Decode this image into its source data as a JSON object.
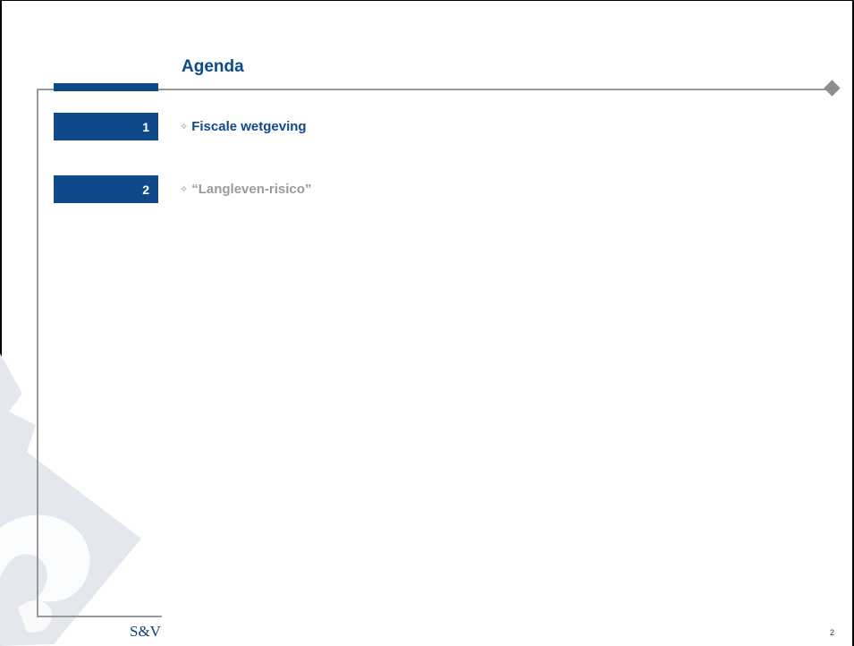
{
  "slide": {
    "title": "Agenda",
    "items": [
      {
        "number": "1",
        "label": "Fiscale wetgeving",
        "state": "active"
      },
      {
        "number": "2",
        "label": "“Langleven-risico”",
        "state": "inactive"
      }
    ],
    "bullet_icon": "diamond-bullet-icon",
    "logo_text": "S&V",
    "page_number": "2"
  },
  "colors": {
    "brand_blue": "#0e4a8a",
    "inactive_gray": "#9b9b9b",
    "frame_gray": "#9a9a9a"
  }
}
